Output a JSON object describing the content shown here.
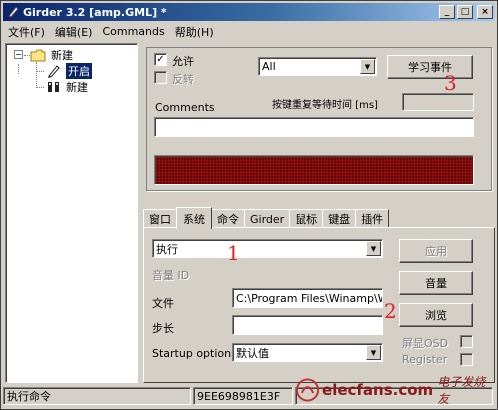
{
  "window": {
    "title": "Girder 3.2 [amp.GML] *"
  },
  "titlebar_buttons": {
    "minimize": "_",
    "maximize": "□",
    "close": "×"
  },
  "menu": [
    "文件(F)",
    "编辑(E)",
    "Commands",
    "帮助(H)"
  ],
  "tree": {
    "root_label": "新建",
    "children": [
      {
        "label": "开启",
        "selected": true,
        "icon": "pencil-icon"
      },
      {
        "label": "新建",
        "selected": false,
        "icon": "remote-icon"
      }
    ]
  },
  "event_panel": {
    "enabled_label": "允许",
    "enabled_checked": true,
    "invert_label": "反转",
    "invert_checked": false,
    "device_select": "All",
    "learn_button": "学习事件",
    "repeat_label": "按键重复等待时间 [ms]",
    "repeat_value": "",
    "comments_label": "Comments",
    "comments_value": "",
    "led_display": ""
  },
  "tabs": [
    "窗口",
    "系统",
    "命令",
    "Girder",
    "鼠标",
    "键盘",
    "插件"
  ],
  "active_tab": "系统",
  "system_tab": {
    "action_select": "执行",
    "volume_id_label": "音量 ID",
    "file_label": "文件",
    "file_value": "C:\\Program Files\\Winamp\\Win",
    "step_label": "步长",
    "step_value": "",
    "startup_label": "Startup options",
    "startup_select": "默认值",
    "apply_button": "应用",
    "volume_button": "音量",
    "browse_button": "浏览",
    "osd_label": "屏显OSD",
    "register_label": "Register"
  },
  "annotations": [
    "1",
    "2",
    "3"
  ],
  "status": {
    "left": "执行命令",
    "code": "9EE698981E3F",
    "watermark": "elecfans.com",
    "watermark_cn": "电子发烧友"
  },
  "colors": {
    "title_start": "#0a246a",
    "title_end": "#a6caf0",
    "face": "#d4d0c8",
    "annotation": "#e02020",
    "led": "#b01010"
  }
}
